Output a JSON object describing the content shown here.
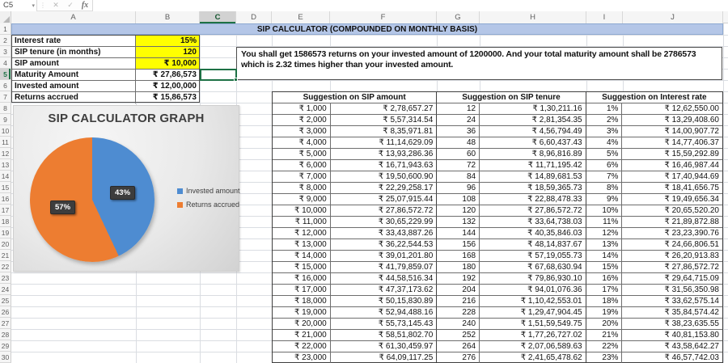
{
  "formula_bar": {
    "name_box": "C5",
    "formula_value": "",
    "icons": {
      "cancel": "✕",
      "enter": "✓",
      "fx": "fx",
      "dropdown": "▾",
      "dots": "⋮"
    }
  },
  "grid": {
    "columns": [
      "A",
      "B",
      "C",
      "D",
      "E",
      "F",
      "G",
      "H",
      "I",
      "J"
    ],
    "rows": [
      "1",
      "2",
      "3",
      "4",
      "5",
      "6",
      "7",
      "8",
      "9",
      "10",
      "11",
      "12",
      "13",
      "14",
      "15",
      "16",
      "17",
      "18",
      "19",
      "20",
      "21",
      "22",
      "23",
      "24",
      "25",
      "26",
      "27",
      "28",
      "29",
      "30"
    ],
    "selected_column": "C",
    "selected_row": "5",
    "selected_cell": "C5"
  },
  "banner": {
    "title": "SIP CALCULATOR (COMPOUNDED ON MONTHLY BASIS)"
  },
  "summary": {
    "rows": [
      {
        "label": "Interest rate",
        "value": "15%",
        "highlight": true
      },
      {
        "label": "SIP tenure (in months)",
        "value": "120",
        "highlight": true
      },
      {
        "label": "SIP amount",
        "value": "₹ 10,000",
        "highlight": true
      },
      {
        "label": "Maturity Amount",
        "value": "₹ 27,86,573",
        "highlight": false
      },
      {
        "label": "Invested amount",
        "value": "₹ 12,00,000",
        "highlight": false
      },
      {
        "label": "Returns accrued",
        "value": "₹ 15,86,573",
        "highlight": false
      }
    ]
  },
  "message": {
    "text": "You shall get 1586573 returns on your invested amount of 1200000. And your total maturity amount shall be 2786573 which is 2.32 times higher than your invested amount."
  },
  "chart_data": {
    "type": "pie",
    "title": "SIP CALCULATOR GRAPH",
    "labels": [
      "Invested amount",
      "Returns accrued"
    ],
    "values": [
      43,
      57
    ],
    "data_labels": [
      "43%",
      "57%"
    ],
    "colors": [
      "#4e8cd1",
      "#ed7d31"
    ],
    "legend_position": "right",
    "start_angle_deg": 0,
    "direction": "clockwise"
  },
  "suggestions": {
    "groups": [
      {
        "header": "Suggestion on SIP amount"
      },
      {
        "header": "Suggestion on SIP tenure"
      },
      {
        "header": "Suggestion on Interest rate"
      }
    ],
    "rows": [
      [
        "₹ 1,000",
        "₹ 2,78,657.27",
        "12",
        "₹ 1,30,211.16",
        "1%",
        "₹ 12,62,550.00"
      ],
      [
        "₹ 2,000",
        "₹ 5,57,314.54",
        "24",
        "₹ 2,81,354.35",
        "2%",
        "₹ 13,29,408.60"
      ],
      [
        "₹ 3,000",
        "₹ 8,35,971.81",
        "36",
        "₹ 4,56,794.49",
        "3%",
        "₹ 14,00,907.72"
      ],
      [
        "₹ 4,000",
        "₹ 11,14,629.09",
        "48",
        "₹ 6,60,437.43",
        "4%",
        "₹ 14,77,406.37"
      ],
      [
        "₹ 5,000",
        "₹ 13,93,286.36",
        "60",
        "₹ 8,96,816.89",
        "5%",
        "₹ 15,59,292.89"
      ],
      [
        "₹ 6,000",
        "₹ 16,71,943.63",
        "72",
        "₹ 11,71,195.42",
        "6%",
        "₹ 16,46,987.44"
      ],
      [
        "₹ 7,000",
        "₹ 19,50,600.90",
        "84",
        "₹ 14,89,681.53",
        "7%",
        "₹ 17,40,944.69"
      ],
      [
        "₹ 8,000",
        "₹ 22,29,258.17",
        "96",
        "₹ 18,59,365.73",
        "8%",
        "₹ 18,41,656.75"
      ],
      [
        "₹ 9,000",
        "₹ 25,07,915.44",
        "108",
        "₹ 22,88,478.33",
        "9%",
        "₹ 19,49,656.34"
      ],
      [
        "₹ 10,000",
        "₹ 27,86,572.72",
        "120",
        "₹ 27,86,572.72",
        "10%",
        "₹ 20,65,520.20"
      ],
      [
        "₹ 11,000",
        "₹ 30,65,229.99",
        "132",
        "₹ 33,64,738.03",
        "11%",
        "₹ 21,89,872.88"
      ],
      [
        "₹ 12,000",
        "₹ 33,43,887.26",
        "144",
        "₹ 40,35,846.03",
        "12%",
        "₹ 23,23,390.76"
      ],
      [
        "₹ 13,000",
        "₹ 36,22,544.53",
        "156",
        "₹ 48,14,837.67",
        "13%",
        "₹ 24,66,806.51"
      ],
      [
        "₹ 14,000",
        "₹ 39,01,201.80",
        "168",
        "₹ 57,19,055.73",
        "14%",
        "₹ 26,20,913.83"
      ],
      [
        "₹ 15,000",
        "₹ 41,79,859.07",
        "180",
        "₹ 67,68,630.94",
        "15%",
        "₹ 27,86,572.72"
      ],
      [
        "₹ 16,000",
        "₹ 44,58,516.34",
        "192",
        "₹ 79,86,930.10",
        "16%",
        "₹ 29,64,715.09"
      ],
      [
        "₹ 17,000",
        "₹ 47,37,173.62",
        "204",
        "₹ 94,01,076.36",
        "17%",
        "₹ 31,56,350.98"
      ],
      [
        "₹ 18,000",
        "₹ 50,15,830.89",
        "216",
        "₹ 1,10,42,553.01",
        "18%",
        "₹ 33,62,575.14"
      ],
      [
        "₹ 19,000",
        "₹ 52,94,488.16",
        "228",
        "₹ 1,29,47,904.45",
        "19%",
        "₹ 35,84,574.42"
      ],
      [
        "₹ 20,000",
        "₹ 55,73,145.43",
        "240",
        "₹ 1,51,59,549.75",
        "20%",
        "₹ 38,23,635.55"
      ],
      [
        "₹ 21,000",
        "₹ 58,51,802.70",
        "252",
        "₹ 1,77,26,727.02",
        "21%",
        "₹ 40,81,153.80"
      ],
      [
        "₹ 22,000",
        "₹ 61,30,459.97",
        "264",
        "₹ 2,07,06,589.63",
        "22%",
        "₹ 43,58,642.27"
      ],
      [
        "₹ 23,000",
        "₹ 64,09,117.25",
        "276",
        "₹ 2,41,65,478.62",
        "23%",
        "₹ 46,57,742.03"
      ]
    ]
  },
  "colors": {
    "banner_blue": "#b4c6e7",
    "highlight_yellow": "#ffff00",
    "selection_green": "#1e7145",
    "pie_blue": "#4e8cd1",
    "pie_orange": "#ed7d31"
  }
}
